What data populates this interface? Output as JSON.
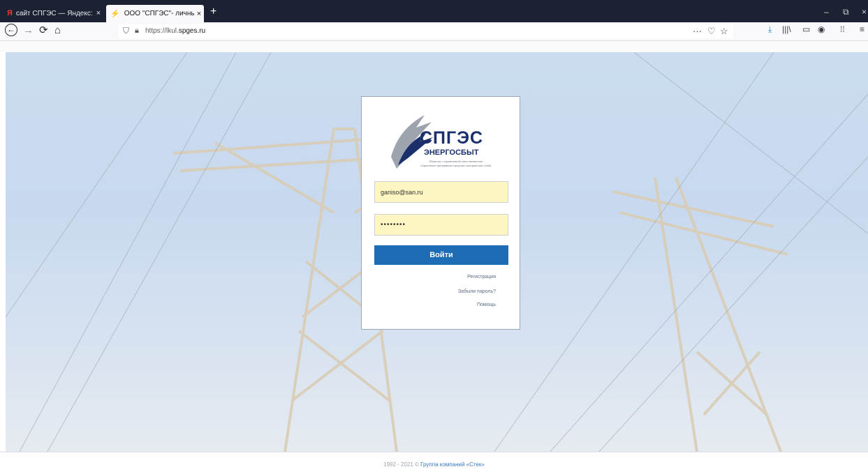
{
  "browser": {
    "tabs": [
      {
        "icon_text": "Я",
        "label": "сайт СПГЭС — Яндекс: нашлс",
        "close": "×"
      },
      {
        "label": "ООО \"СПГЭС\"- личный кабин",
        "close": "×"
      }
    ],
    "new_tab": "+",
    "window_controls": {
      "minimize": "–",
      "restore": "⧉",
      "close": "×"
    },
    "nav": {
      "back": "←",
      "forward": "→",
      "reload": "⟳",
      "home": "⌂"
    },
    "url_prefix": "https://lkul.",
    "url_domain": "spges.ru",
    "url_actions": {
      "more": "···",
      "pocket": "♡",
      "bookmark": "☆"
    },
    "toolbar": {
      "download": "⤓",
      "library": "|||\\",
      "sidebar": "▭",
      "account": "◉",
      "extensions": "⁞⁞",
      "menu": "≡"
    }
  },
  "card": {
    "brand": "СПГЭС",
    "brand_sub": "ЭНЕРГОСБЫТ",
    "legal_line1": "Общество с ограниченной ответственностью",
    "legal_line2": "«Саратовское предприятие городских электрических сетей»",
    "login_value": "ganiso@san.ru",
    "password_value": "••••••••",
    "login_button": "Войти",
    "link_register": "Регистрация",
    "link_forgot": "Забыли пароль?",
    "link_help": "Помощь"
  },
  "footer": {
    "text": "1992 - 2021 © ",
    "link": "Группа компаний «Стек»"
  },
  "colors": {
    "accent": "#1c6db5",
    "brand_navy": "#1b2f6c",
    "input_fill": "#fdf6c3"
  }
}
